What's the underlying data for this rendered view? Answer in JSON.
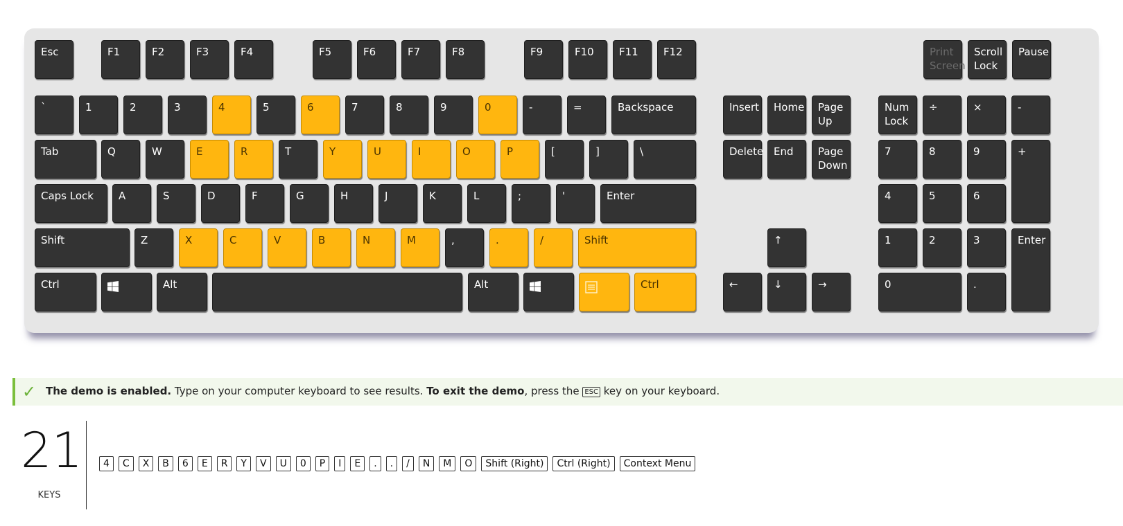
{
  "colors": {
    "key": "#333333",
    "pressed": "#ffb60f",
    "accent": "#7bbf3c"
  },
  "keyboard": {
    "keys": [
      {
        "id": "esc",
        "label": "Esc",
        "pressed": false
      },
      {
        "id": "f1",
        "label": "F1",
        "pressed": false
      },
      {
        "id": "f2",
        "label": "F2",
        "pressed": false
      },
      {
        "id": "f3",
        "label": "F3",
        "pressed": false
      },
      {
        "id": "f4",
        "label": "F4",
        "pressed": false
      },
      {
        "id": "f5",
        "label": "F5",
        "pressed": false
      },
      {
        "id": "f6",
        "label": "F6",
        "pressed": false
      },
      {
        "id": "f7",
        "label": "F7",
        "pressed": false
      },
      {
        "id": "f8",
        "label": "F8",
        "pressed": false
      },
      {
        "id": "f9",
        "label": "F9",
        "pressed": false
      },
      {
        "id": "f10",
        "label": "F10",
        "pressed": false
      },
      {
        "id": "f11",
        "label": "F11",
        "pressed": false
      },
      {
        "id": "f12",
        "label": "F12",
        "pressed": false
      },
      {
        "id": "print-screen",
        "label": "Print\nScreen",
        "pressed": false,
        "dim": true
      },
      {
        "id": "scroll-lock",
        "label": "Scroll\nLock",
        "pressed": false
      },
      {
        "id": "pause",
        "label": "Pause",
        "pressed": false
      },
      {
        "id": "backtick",
        "label": "`",
        "pressed": false
      },
      {
        "id": "1",
        "label": "1",
        "pressed": false
      },
      {
        "id": "2",
        "label": "2",
        "pressed": false
      },
      {
        "id": "3",
        "label": "3",
        "pressed": false
      },
      {
        "id": "4",
        "label": "4",
        "pressed": true
      },
      {
        "id": "5",
        "label": "5",
        "pressed": false
      },
      {
        "id": "6",
        "label": "6",
        "pressed": true
      },
      {
        "id": "7",
        "label": "7",
        "pressed": false
      },
      {
        "id": "8",
        "label": "8",
        "pressed": false
      },
      {
        "id": "9",
        "label": "9",
        "pressed": false
      },
      {
        "id": "0",
        "label": "0",
        "pressed": true
      },
      {
        "id": "minus",
        "label": "-",
        "pressed": false
      },
      {
        "id": "equals",
        "label": "=",
        "pressed": false
      },
      {
        "id": "backspace",
        "label": "Backspace",
        "pressed": false
      },
      {
        "id": "insert",
        "label": "Insert",
        "pressed": false
      },
      {
        "id": "home",
        "label": "Home",
        "pressed": false
      },
      {
        "id": "page-up",
        "label": "Page\nUp",
        "pressed": false
      },
      {
        "id": "num-lock",
        "label": "Num\nLock",
        "pressed": false
      },
      {
        "id": "num-divide",
        "label": "÷",
        "pressed": false
      },
      {
        "id": "num-multiply",
        "label": "×",
        "pressed": false
      },
      {
        "id": "num-minus",
        "label": "-",
        "pressed": false
      },
      {
        "id": "tab",
        "label": "Tab",
        "pressed": false
      },
      {
        "id": "q",
        "label": "Q",
        "pressed": false
      },
      {
        "id": "w",
        "label": "W",
        "pressed": false
      },
      {
        "id": "e",
        "label": "E",
        "pressed": true
      },
      {
        "id": "r",
        "label": "R",
        "pressed": true
      },
      {
        "id": "t",
        "label": "T",
        "pressed": false
      },
      {
        "id": "y",
        "label": "Y",
        "pressed": true
      },
      {
        "id": "u",
        "label": "U",
        "pressed": true
      },
      {
        "id": "i",
        "label": "I",
        "pressed": true
      },
      {
        "id": "o",
        "label": "O",
        "pressed": true
      },
      {
        "id": "p",
        "label": "P",
        "pressed": true
      },
      {
        "id": "lbracket",
        "label": "[",
        "pressed": false
      },
      {
        "id": "rbracket",
        "label": "]",
        "pressed": false
      },
      {
        "id": "backslash",
        "label": "\\",
        "pressed": false
      },
      {
        "id": "delete",
        "label": "Delete",
        "pressed": false
      },
      {
        "id": "end",
        "label": "End",
        "pressed": false
      },
      {
        "id": "page-down",
        "label": "Page\nDown",
        "pressed": false
      },
      {
        "id": "num-7",
        "label": "7",
        "pressed": false
      },
      {
        "id": "num-8",
        "label": "8",
        "pressed": false
      },
      {
        "id": "num-9",
        "label": "9",
        "pressed": false
      },
      {
        "id": "num-plus",
        "label": "+",
        "pressed": false
      },
      {
        "id": "caps-lock",
        "label": "Caps Lock",
        "pressed": false
      },
      {
        "id": "a",
        "label": "A",
        "pressed": false
      },
      {
        "id": "s",
        "label": "S",
        "pressed": false
      },
      {
        "id": "d",
        "label": "D",
        "pressed": false
      },
      {
        "id": "f",
        "label": "F",
        "pressed": false
      },
      {
        "id": "g",
        "label": "G",
        "pressed": false
      },
      {
        "id": "h",
        "label": "H",
        "pressed": false
      },
      {
        "id": "j",
        "label": "J",
        "pressed": false
      },
      {
        "id": "k",
        "label": "K",
        "pressed": false
      },
      {
        "id": "l",
        "label": "L",
        "pressed": false
      },
      {
        "id": "semicolon",
        "label": ";",
        "pressed": false
      },
      {
        "id": "quote",
        "label": "'",
        "pressed": false
      },
      {
        "id": "enter",
        "label": "Enter",
        "pressed": false
      },
      {
        "id": "num-4",
        "label": "4",
        "pressed": false
      },
      {
        "id": "num-5",
        "label": "5",
        "pressed": false
      },
      {
        "id": "num-6",
        "label": "6",
        "pressed": false
      },
      {
        "id": "shift-left",
        "label": "Shift",
        "pressed": false
      },
      {
        "id": "z",
        "label": "Z",
        "pressed": false
      },
      {
        "id": "x",
        "label": "X",
        "pressed": true
      },
      {
        "id": "c",
        "label": "C",
        "pressed": true
      },
      {
        "id": "v",
        "label": "V",
        "pressed": true
      },
      {
        "id": "b",
        "label": "B",
        "pressed": true
      },
      {
        "id": "n",
        "label": "N",
        "pressed": true
      },
      {
        "id": "m",
        "label": "M",
        "pressed": true
      },
      {
        "id": "comma",
        "label": ",",
        "pressed": false
      },
      {
        "id": "period",
        "label": ".",
        "pressed": true
      },
      {
        "id": "slash",
        "label": "/",
        "pressed": true
      },
      {
        "id": "shift-right",
        "label": "Shift",
        "pressed": true
      },
      {
        "id": "arrow-up",
        "label": "↑",
        "pressed": false
      },
      {
        "id": "num-1",
        "label": "1",
        "pressed": false
      },
      {
        "id": "num-2",
        "label": "2",
        "pressed": false
      },
      {
        "id": "num-3",
        "label": "3",
        "pressed": false
      },
      {
        "id": "num-enter",
        "label": "Enter",
        "pressed": false
      },
      {
        "id": "ctrl-left",
        "label": "Ctrl",
        "pressed": false
      },
      {
        "id": "win-left",
        "label": "",
        "icon": "windows-icon",
        "pressed": false
      },
      {
        "id": "alt-left",
        "label": "Alt",
        "pressed": false
      },
      {
        "id": "space",
        "label": "",
        "pressed": false
      },
      {
        "id": "alt-right",
        "label": "Alt",
        "pressed": false
      },
      {
        "id": "win-right",
        "label": "",
        "icon": "windows-icon",
        "pressed": false
      },
      {
        "id": "context-menu",
        "label": "",
        "icon": "context-menu-icon",
        "pressed": true
      },
      {
        "id": "ctrl-right",
        "label": "Ctrl",
        "pressed": true
      },
      {
        "id": "arrow-left",
        "label": "←",
        "pressed": false
      },
      {
        "id": "arrow-down",
        "label": "↓",
        "pressed": false
      },
      {
        "id": "arrow-right",
        "label": "→",
        "pressed": false
      },
      {
        "id": "num-0",
        "label": "0",
        "pressed": false
      },
      {
        "id": "num-decimal",
        "label": ".",
        "pressed": false
      }
    ]
  },
  "notice": {
    "icon": "check-icon",
    "check_glyph": "✓",
    "bold1": "The demo is enabled.",
    "text1": " Type on your computer keyboard to see results.  ",
    "bold2": "To exit the demo",
    "text2": ", press the ",
    "esc_label": "ESC",
    "text3": " key on your keyboard."
  },
  "summary": {
    "count": "21",
    "count_label": "KEYS",
    "pressed_keys": [
      "4",
      "C",
      "X",
      "B",
      "6",
      "E",
      "R",
      "Y",
      "V",
      "U",
      "0",
      "P",
      "I",
      "E",
      ".",
      ".",
      "/",
      "N",
      "M",
      "O",
      "Shift (Right)",
      "Ctrl (Right)",
      "Context Menu"
    ]
  }
}
